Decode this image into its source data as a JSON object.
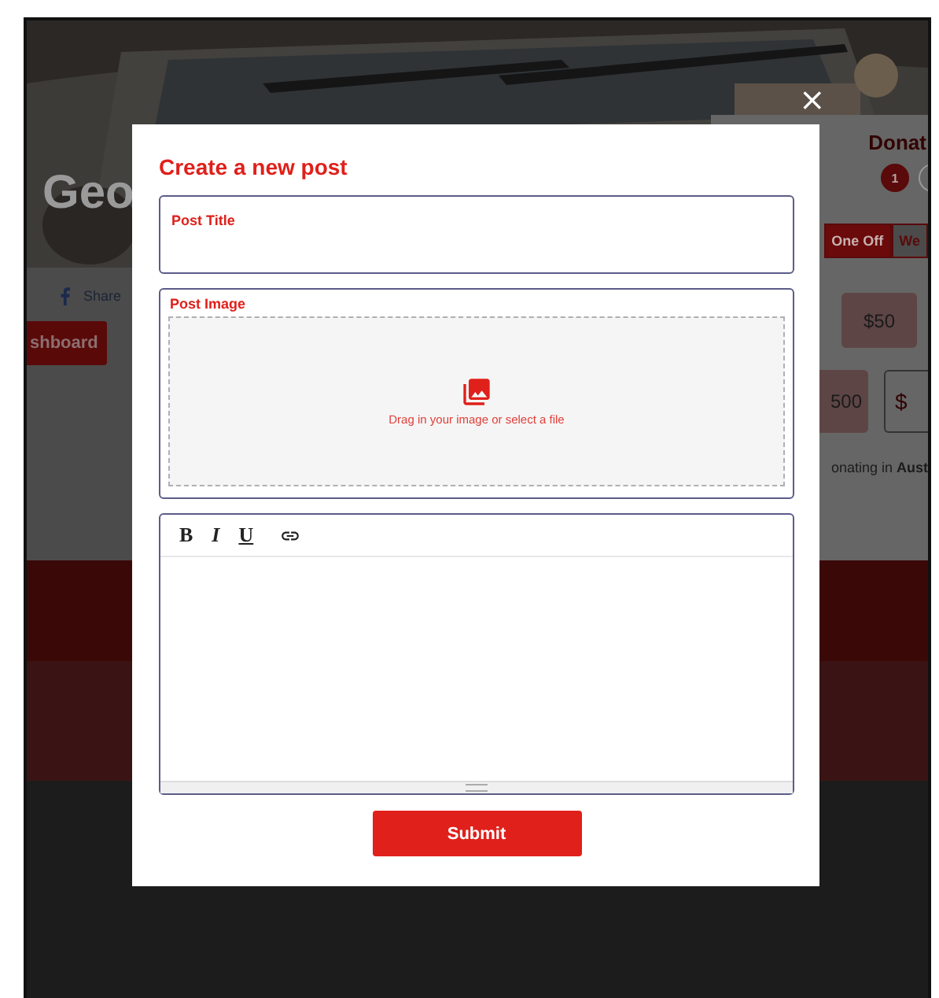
{
  "background_page": {
    "hero": {
      "kind": "picture",
      "heading": "Geo"
    },
    "share_label": "Share",
    "dashboard_button": "shboard",
    "donate_panel": {
      "heading": "Donat",
      "steps": [
        {
          "label": "1",
          "selected": true
        },
        {
          "selected": false
        }
      ],
      "frequency_tabs": [
        {
          "label": "One Off",
          "selected": true
        },
        {
          "label": "We",
          "selected": false
        }
      ],
      "amounts": [
        "$50",
        "500"
      ],
      "custom_amount_prefix": "$",
      "location_note": "onating in **Aust**"
    }
  },
  "modal": {
    "close": "×",
    "title": "Create a new post",
    "post_title": {
      "label": "Post Title"
    },
    "post_image": {
      "label": "Post Image",
      "hint": "Drag in your image or select a file"
    },
    "editor": {
      "toolbar": [
        {
          "kind": "bold",
          "label": "B"
        },
        {
          "kind": "italic",
          "label": "I"
        },
        {
          "kind": "underline",
          "label": "U"
        },
        {
          "kind": "link"
        }
      ]
    },
    "submit": "Submit"
  }
}
